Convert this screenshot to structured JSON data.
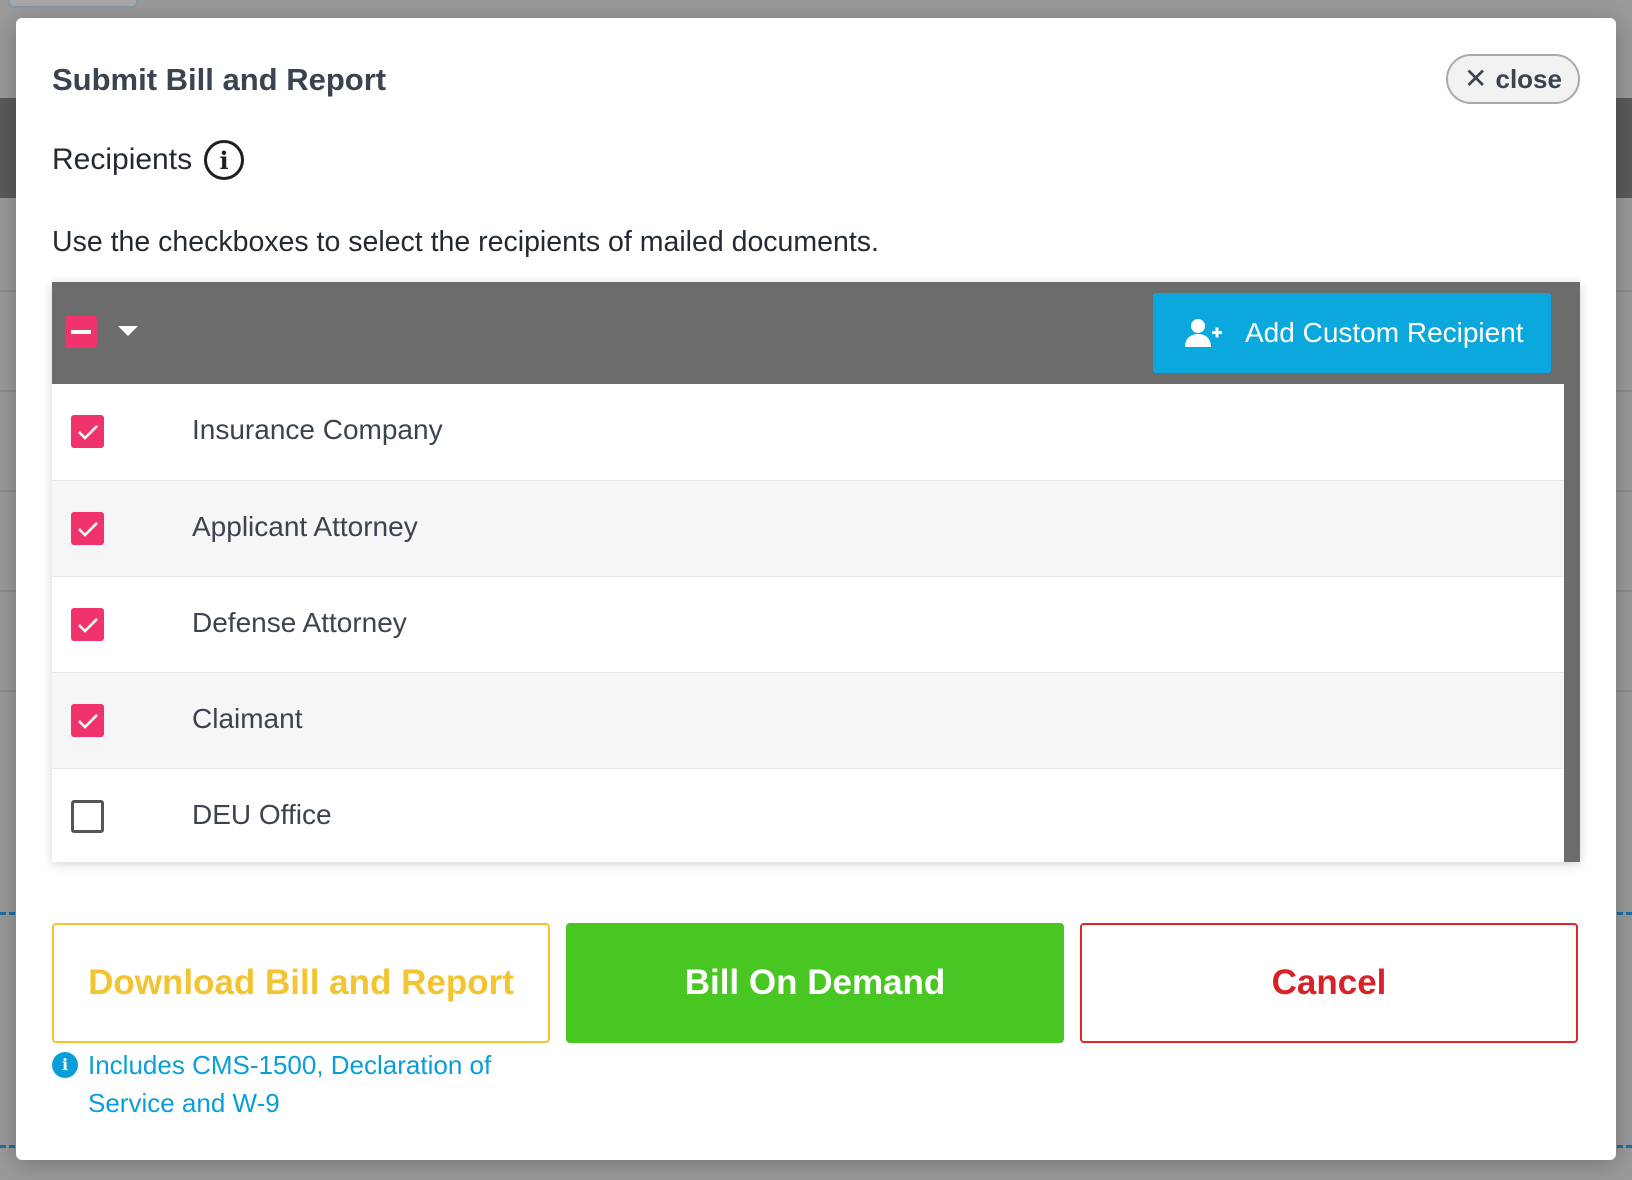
{
  "modal": {
    "title": "Submit Bill and Report",
    "close_label": "close"
  },
  "recipients": {
    "label": "Recipients",
    "instructions": "Use the checkboxes to select the recipients of mailed documents.",
    "add_button_label": "Add Custom Recipient",
    "rows": [
      {
        "label": "Insurance Company",
        "checked": true
      },
      {
        "label": "Applicant Attorney",
        "checked": true
      },
      {
        "label": "Defense Attorney",
        "checked": true
      },
      {
        "label": "Claimant",
        "checked": true
      },
      {
        "label": "DEU Office",
        "checked": false
      }
    ]
  },
  "actions": {
    "download_label": "Download Bill and Report",
    "bill_label": "Bill On Demand",
    "cancel_label": "Cancel",
    "download_note": "Includes CMS-1500, Declaration of Service and W-9"
  },
  "icons": {
    "close": "close-icon",
    "info": "info-icon",
    "master_checkbox": "indeterminate-checkbox",
    "dropdown": "caret-down-icon",
    "add_user": "user-plus-icon",
    "check": "checkmark-icon"
  },
  "colors": {
    "accent_pink": "#f0336c",
    "add_button_blue": "#0aa8dd",
    "download_yellow": "#f2c431",
    "bill_green": "#48c622",
    "cancel_red": "#d62329",
    "note_blue": "#0a9ed8",
    "table_header_gray": "#6c6c6c"
  }
}
